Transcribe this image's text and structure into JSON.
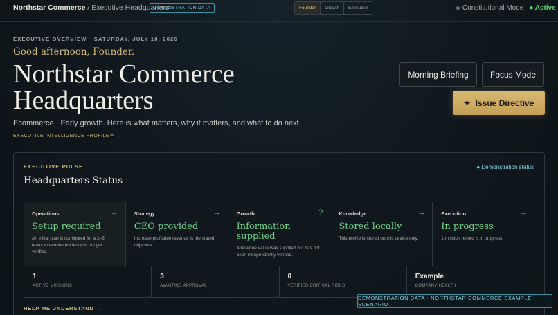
{
  "topbar": {
    "brand": "Northstar Commerce",
    "separator": " / ",
    "subtitle": "Executive Headquarters",
    "demo_badge": "DEMONSTRATION DATA",
    "modes": [
      {
        "label": "Founder",
        "active": true
      },
      {
        "label": "Growth",
        "active": false
      },
      {
        "label": "Executive",
        "active": false
      }
    ],
    "mode_label": "Constitutional Mode",
    "mode_state": "● Active",
    "mode_icon": "diamond-icon"
  },
  "hero": {
    "eyebrow": "EXECUTIVE OVERVIEW · SATURDAY, JULY 18, 2026",
    "greeting": "Good afternoon, Founder.",
    "headline": "Northstar Commerce Headquarters",
    "tagline": "Ecommerce · Early growth. Here is what matters, why it matters, and what to do next.",
    "profile_link": "EXECUTIVE INTELLIGENCE PROFILE™ →"
  },
  "actions": {
    "briefing": "Morning Briefing",
    "focus": "Focus Mode",
    "issue": "Issue Directive",
    "issue_icon": "sparkle-icon"
  },
  "pulse": {
    "eyebrow": "EXECUTIVE PULSE",
    "status": "● Demonstration status",
    "title": "Headquarters Status",
    "cards": [
      {
        "label": "Operations",
        "indicator": "→",
        "value": "Setup required",
        "desc": "An initial plan is configured for a 2–5 team; execution evidence is not yet verified."
      },
      {
        "label": "Strategy",
        "indicator": "→",
        "value": "CEO provided",
        "desc": "Increase profitable revenue is the stated objective."
      },
      {
        "label": "Growth",
        "indicator": "?",
        "value": "Information supplied",
        "desc": "A revenue value was supplied but has not been independently verified."
      },
      {
        "label": "Knowledge",
        "indicator": "→",
        "value": "Stored locally",
        "desc": "This profile is stored on this device only."
      },
      {
        "label": "Execution",
        "indicator": "→",
        "value": "In progress",
        "desc": "1 mission record is in progress."
      }
    ],
    "stats": [
      {
        "value": "1",
        "label": "ACTIVE MISSIONS"
      },
      {
        "value": "3",
        "label": "AWAITING APPROVAL"
      },
      {
        "value": "0",
        "label": "VERIFIED CRITICAL RISKS"
      },
      {
        "value": "Example",
        "label": "COMPANY HEALTH"
      }
    ],
    "help": "HELP ME UNDERSTAND →"
  },
  "footer": {
    "demo": "DEMONSTRATION DATA · NORTHSTAR COMMERCE EXAMPLE SCENARIO"
  },
  "colors": {
    "accent_gold": "#d3b77a",
    "status_green": "#6fd58a",
    "info_cyan": "#7fd0e0",
    "background": "#0f171c"
  }
}
